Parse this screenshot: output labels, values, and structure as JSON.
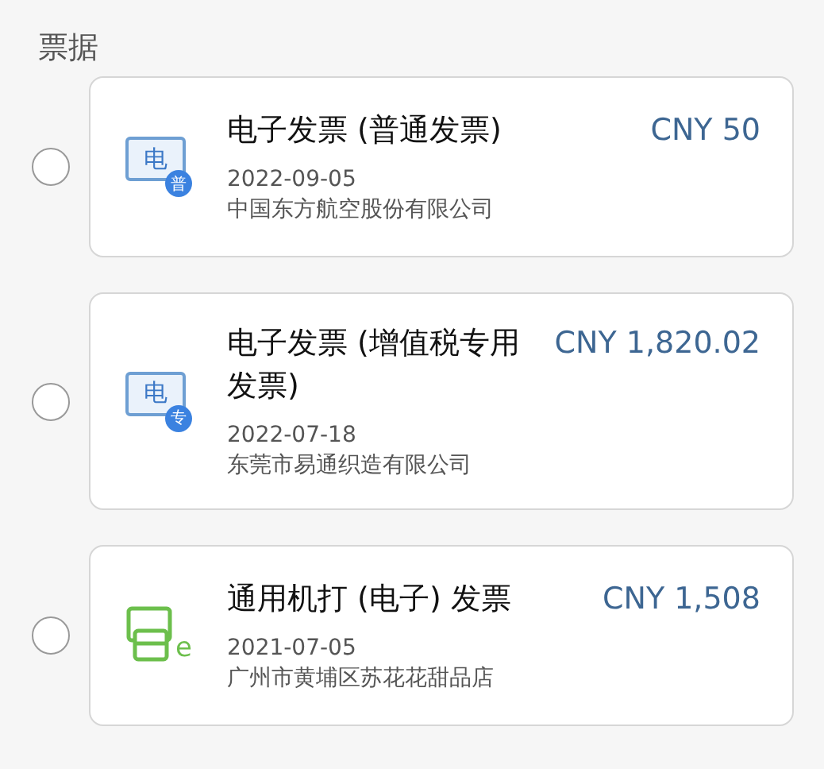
{
  "section_title": "票据",
  "invoices": [
    {
      "selected": false,
      "kind": "electronic",
      "icon_char": "电",
      "badge": "普",
      "title": "电子发票 (普通发票)",
      "amount": "CNY 50",
      "date": "2022-09-05",
      "seller": "中国东方航空股份有限公司"
    },
    {
      "selected": false,
      "kind": "electronic",
      "icon_char": "电",
      "badge": "专",
      "title": "电子发票 (增值税专用发票)",
      "amount": "CNY 1,820.02",
      "date": "2022-07-18",
      "seller": "东莞市易通织造有限公司"
    },
    {
      "selected": false,
      "kind": "machine",
      "icon_char": "e",
      "title": "通用机打 (电子) 发票",
      "amount": "CNY 1,508",
      "date": "2021-07-05",
      "seller": "广州市黄埔区苏花花甜品店"
    }
  ]
}
